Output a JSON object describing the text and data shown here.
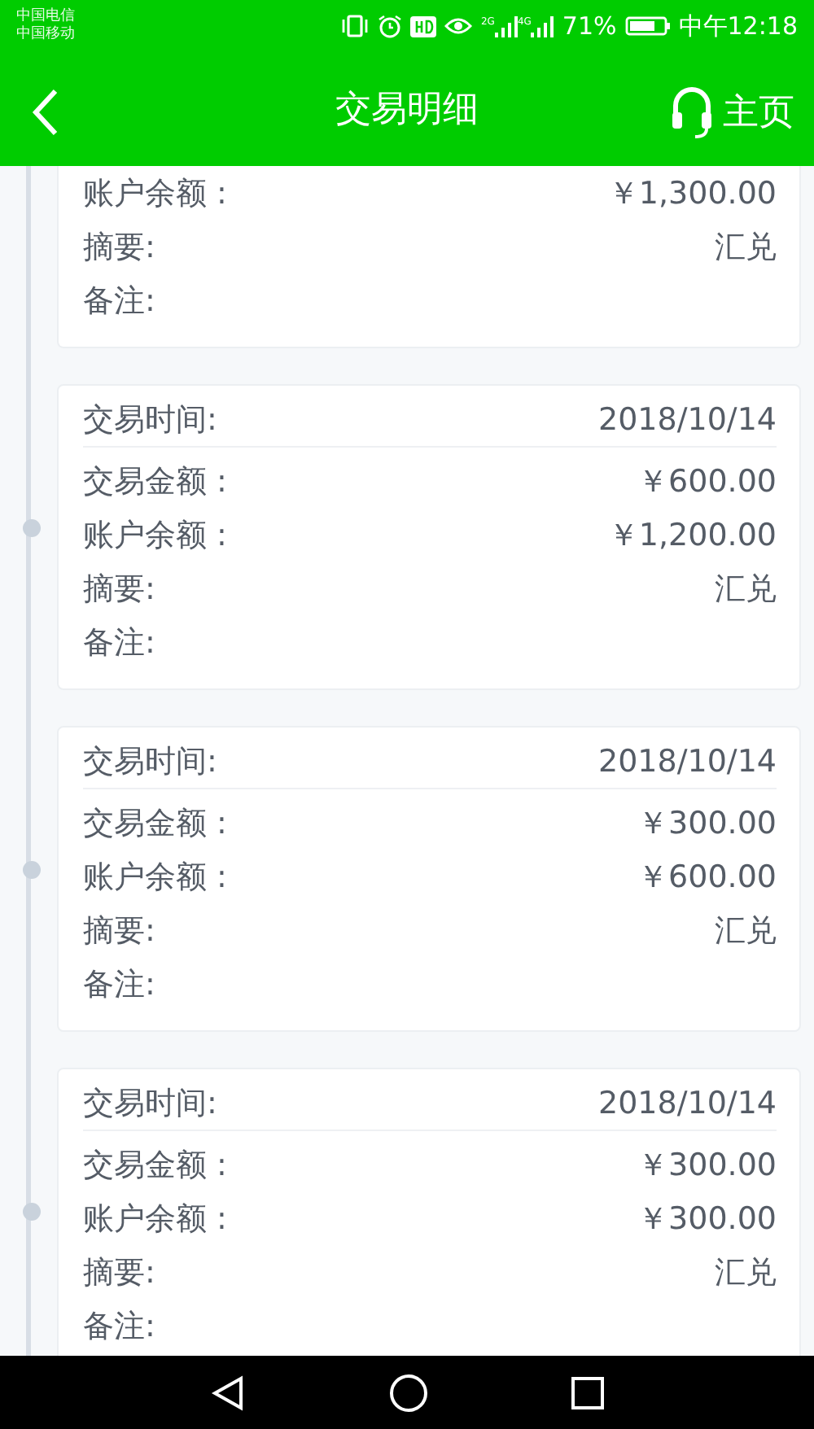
{
  "status_bar": {
    "carriers": [
      "中国电信",
      "中国移动"
    ],
    "network_labels": [
      "2G",
      "4G"
    ],
    "battery": "71%",
    "time": "中午12:18"
  },
  "header": {
    "title": "交易明细",
    "home": "主页"
  },
  "cards": [
    {
      "rows": [
        {
          "label": "账户余额 :",
          "value": "￥1,300.00"
        },
        {
          "label": "摘要:",
          "value": "汇兑"
        },
        {
          "label": "备注:"
        }
      ]
    },
    {
      "time_label": "交易时间:",
      "time": "2018/10/14",
      "rows": [
        {
          "label": "交易金额 :",
          "value": "￥600.00"
        },
        {
          "label": "账户余额 :",
          "value": "￥1,200.00"
        },
        {
          "label": "摘要:",
          "value": "汇兑"
        },
        {
          "label": "备注:"
        }
      ]
    },
    {
      "time_label": "交易时间:",
      "time": "2018/10/14",
      "rows": [
        {
          "label": "交易金额 :",
          "value": "￥300.00"
        },
        {
          "label": "账户余额 :",
          "value": "￥600.00"
        },
        {
          "label": "摘要:",
          "value": "汇兑"
        },
        {
          "label": "备注:"
        }
      ]
    },
    {
      "time_label": "交易时间:",
      "time": "2018/10/14",
      "rows": [
        {
          "label": "交易金额 :",
          "value": "￥300.00"
        },
        {
          "label": "账户余额 :",
          "value": "￥300.00"
        },
        {
          "label": "摘要:",
          "value": "汇兑"
        },
        {
          "label": "备注:"
        }
      ]
    }
  ]
}
